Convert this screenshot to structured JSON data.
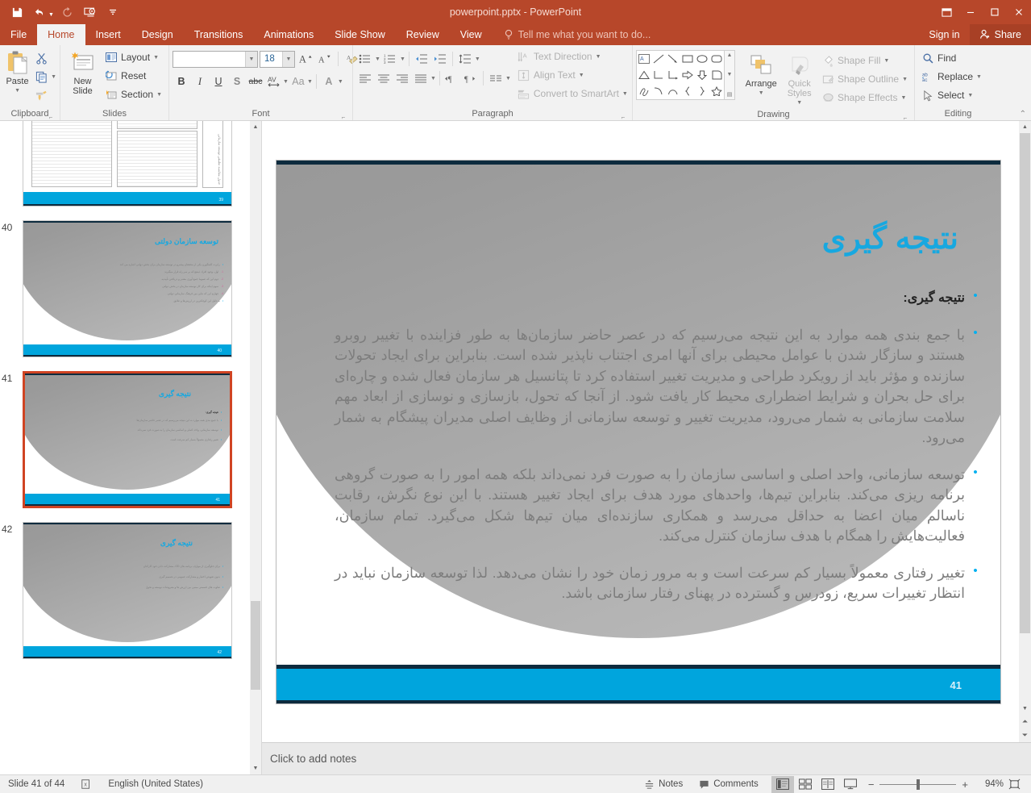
{
  "window": {
    "title": "powerpoint.pptx - PowerPoint",
    "quick_access": [
      {
        "name": "save",
        "icon": "save-icon",
        "label": "Save"
      },
      {
        "name": "undo",
        "icon": "undo-icon",
        "label": "Undo"
      },
      {
        "name": "redo",
        "icon": "redo-icon",
        "label": "Redo"
      },
      {
        "name": "start-slideshow",
        "icon": "slideshow-icon",
        "label": "Start From Beginning"
      },
      {
        "name": "customize-qat",
        "icon": "chevron-down-icon",
        "label": "Customize Quick Access Toolbar"
      }
    ],
    "controls": {
      "restore": "❐",
      "minimize": "─",
      "maximize": "☐",
      "close": "✕"
    }
  },
  "tabs": {
    "file": "File",
    "items": [
      "Home",
      "Insert",
      "Design",
      "Transitions",
      "Animations",
      "Slide Show",
      "Review",
      "View"
    ],
    "active": "Home",
    "tellme": "Tell me what you want to do...",
    "signin": "Sign in",
    "share": "Share"
  },
  "ribbon": {
    "groups": [
      {
        "name": "Clipboard",
        "label": "Clipboard",
        "paste": "Paste",
        "items": [
          "Cut",
          "Copy",
          "Format Painter"
        ]
      },
      {
        "name": "Slides",
        "label": "Slides",
        "new_slide": "New Slide",
        "layout": "Layout",
        "reset": "Reset",
        "section": "Section"
      },
      {
        "name": "Font",
        "label": "Font",
        "font_name": "",
        "font_name_placeholder": "",
        "font_size": "18",
        "buttons": [
          "Increase Font Size",
          "Decrease Font Size",
          "Clear All Formatting",
          "Bold",
          "Italic",
          "Underline",
          "Text Shadow",
          "Strikethrough",
          "Character Spacing",
          "Change Case",
          "Font Color"
        ],
        "bold": "B",
        "italic": "I",
        "underline": "U",
        "shadow": "S",
        "strike": "abc",
        "spacing": "AV",
        "case": "Aa",
        "color": "A"
      },
      {
        "name": "Paragraph",
        "label": "Paragraph",
        "text_direction": "Text Direction",
        "align_text": "Align Text",
        "convert_smartart": "Convert to SmartArt"
      },
      {
        "name": "Drawing",
        "label": "Drawing",
        "arrange": "Arrange",
        "quick_styles": "Quick Styles",
        "shape_fill": "Shape Fill",
        "shape_outline": "Shape Outline",
        "shape_effects": "Shape Effects"
      },
      {
        "name": "Editing",
        "label": "Editing",
        "find": "Find",
        "replace": "Replace",
        "select": "Select"
      }
    ]
  },
  "thumbnails": [
    {
      "number": "",
      "selected": false,
      "title": "",
      "page": "",
      "kind": "table",
      "body": []
    },
    {
      "number": "40",
      "selected": false,
      "title": "توسعه سازمان دولتی",
      "page": "40",
      "kind": "text",
      "body": [
        "رابرت کلیتگورن یکی از محققان پیشرو در توسعه سازمان برای بخش دولتی اشاره می کند",
        "اول، وجود افراد ذینفع که بر سر راه قرار میگیرند",
        "دوم این که عموما جمع آوری معتبر و دریافتن تأییدیه",
        "سوم اینکه برای کار توسعه سازمان در بخش دولتی",
        "چهارم این که تباین بین فرهنگ سازمانی دولتی",
        "به دلیل این کوچکترین در ارزش‌ها و علایق"
      ]
    },
    {
      "number": "41",
      "selected": true,
      "title": "نتیجه گیری",
      "page": "41",
      "kind": "text",
      "body": [
        "نتیجه گیری:",
        "با جمع بندی همه موارد به این نتیجه می‌رسیم که در عصر حاضر سازمان‌ها",
        "توسعه سازمانی، واحد اصلی و اساسی سازمان را به صورت فرد نمی‌داند",
        "تغییر رفتاری معمولاً بسیار کم سرعت است"
      ]
    },
    {
      "number": "42",
      "selected": false,
      "title": "نتیجه گیری",
      "page": "42",
      "kind": "text",
      "body": [
        "برای جلوگیری از موارف برنامه های OD، مشارکت دادن خود کارکنان",
        "بدون تفویض اختیار و مشارکت عمومی در تصمیم گیری",
        "تفاوت های قسمتی مبنیی بین ارزش ها و مفروضات توسعه و تحول"
      ]
    }
  ],
  "slide": {
    "title": "نتیجه گیری",
    "page_number": "41",
    "bullets": [
      {
        "lead": true,
        "text": "نتیجه گیری:"
      },
      {
        "lead": false,
        "text": "با جمع بندی همه موارد به این نتیجه می‌رسیم که در عصر حاضر سازمان‌ها به طور فزاینده با تغییر روبرو هستند و سازگار شدن با عوامل محیطی برای آنها امری اجتناب ناپذیر شده است. بنابراین برای ایجاد تحولات سازنده و مؤثر باید از رویکرد طراحی و مدیریت تغییر استفاده کرد تا پتانسیل هر سازمان فعال شده و چاره‌ای برای حل بحران و شرایط اضطراری محیط کار یافت شود. از آنجا که تحول، بازسازی و نوسازی از ابعاد مهم سلامت سازمانی به شمار می‌رود، مدیریت تغییر و توسعه سازمانی از وظایف اصلی مدیران پیشگام به شمار می‌رود."
      },
      {
        "lead": false,
        "text": "توسعه سازمانی، واحد اصلی و اساسی سازمان را به صورت فرد نمی‌داند بلکه همه امور را به صورت گروهی برنامه ریزی می‌کند. بنابراین تیم‌ها، واحدهای مورد هدف برای ایجاد تغییر هستند. با این نوع نگرش، رقابت ناسالم میان اعضا به حداقل می‌رسد و همکاری سازنده‌ای میان تیم‌ها شکل می‌گیرد. تمام سازمان، فعالیت‌هایش را همگام با هدف سازمان کنترل می‌کند."
      },
      {
        "lead": false,
        "text": "تغییر رفتاری معمولاً بسیار کم سرعت است و به مرور زمان خود را نشان می‌دهد. لذا توسعه سازمان نباید در انتظار تغییرات سریع، زودرس و گسترده در پهنای رفتار سازمانی باشد."
      }
    ]
  },
  "notes": {
    "placeholder": "Click to add notes"
  },
  "status": {
    "slide_counter": "Slide 41 of 44",
    "language": "English (United States)",
    "notes": "Notes",
    "comments": "Comments",
    "zoom": "94%",
    "views": [
      "Normal",
      "Slide Sorter",
      "Reading View",
      "Slide Show"
    ]
  },
  "colors": {
    "accent": "#b7472a",
    "slide_accent": "#00a5dd",
    "title_blue": "#17a8e0",
    "body_gray": "#7d7d7d"
  }
}
